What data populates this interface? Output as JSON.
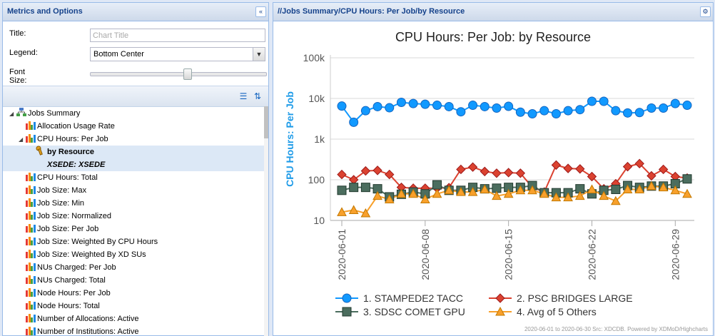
{
  "left_panel": {
    "title": "Metrics and Options",
    "collapse_icon": "double-chevron-left-icon",
    "form": {
      "title_label": "Title:",
      "title_placeholder": "Chart Title",
      "legend_label": "Legend:",
      "legend_value": "Bottom Center",
      "font_size_label": "Font Size:",
      "font_size_level": 0.55
    },
    "toolbar_icons": [
      "list-icon",
      "refresh-icon"
    ],
    "tree": [
      {
        "label": "Jobs Summary",
        "level": 0,
        "icon": "realm-icon",
        "expanded": true
      },
      {
        "label": "Allocation Usage Rate",
        "level": 1,
        "icon": "bar-chart-icon"
      },
      {
        "label": "CPU Hours: Per Job",
        "level": 1,
        "icon": "bar-chart-icon",
        "expanded": true
      },
      {
        "label": "by Resource",
        "level": 2,
        "icon": "key-icon",
        "bold": true,
        "selected": true
      },
      {
        "label": "XSEDE: XSEDE",
        "level": 2,
        "bold": true,
        "italic": true,
        "selected": true
      },
      {
        "label": "CPU Hours: Total",
        "level": 1,
        "icon": "bar-chart-icon"
      },
      {
        "label": "Job Size: Max",
        "level": 1,
        "icon": "bar-chart-icon"
      },
      {
        "label": "Job Size: Min",
        "level": 1,
        "icon": "bar-chart-icon"
      },
      {
        "label": "Job Size: Normalized",
        "level": 1,
        "icon": "bar-chart-icon"
      },
      {
        "label": "Job Size: Per Job",
        "level": 1,
        "icon": "bar-chart-icon"
      },
      {
        "label": "Job Size: Weighted By CPU Hours",
        "level": 1,
        "icon": "bar-chart-icon"
      },
      {
        "label": "Job Size: Weighted By XD SUs",
        "level": 1,
        "icon": "bar-chart-icon"
      },
      {
        "label": "NUs Charged: Per Job",
        "level": 1,
        "icon": "bar-chart-icon"
      },
      {
        "label": "NUs Charged: Total",
        "level": 1,
        "icon": "bar-chart-icon"
      },
      {
        "label": "Node Hours: Per Job",
        "level": 1,
        "icon": "bar-chart-icon"
      },
      {
        "label": "Node Hours: Total",
        "level": 1,
        "icon": "bar-chart-icon"
      },
      {
        "label": "Number of Allocations: Active",
        "level": 1,
        "icon": "bar-chart-icon"
      },
      {
        "label": "Number of Institutions: Active",
        "level": 1,
        "icon": "bar-chart-icon"
      }
    ]
  },
  "right_panel": {
    "title": "//Jobs Summary/CPU Hours: Per Job/by Resource",
    "gear_icon": "gear-icon"
  },
  "colors": {
    "accent": "#15428b",
    "s1": "#1199ff",
    "s2": "#db4230",
    "s3": "#4b6d5e",
    "s4": "#f8a02b"
  },
  "chart_data": {
    "type": "line",
    "title": "CPU Hours: Per Job: by Resource",
    "ylabel": "CPU Hours: Per Job",
    "yscale": "log",
    "ylim": [
      10,
      100000
    ],
    "yticks": [
      "10",
      "100",
      "1k",
      "10k",
      "100k"
    ],
    "x": [
      "2020-06-01",
      "2020-06-02",
      "2020-06-03",
      "2020-06-04",
      "2020-06-05",
      "2020-06-06",
      "2020-06-07",
      "2020-06-08",
      "2020-06-09",
      "2020-06-10",
      "2020-06-11",
      "2020-06-12",
      "2020-06-13",
      "2020-06-14",
      "2020-06-15",
      "2020-06-16",
      "2020-06-17",
      "2020-06-18",
      "2020-06-19",
      "2020-06-20",
      "2020-06-21",
      "2020-06-22",
      "2020-06-23",
      "2020-06-24",
      "2020-06-25",
      "2020-06-26",
      "2020-06-27",
      "2020-06-28",
      "2020-06-29",
      "2020-06-30"
    ],
    "xticks": [
      "2020-06-01",
      "2020-06-08",
      "2020-06-15",
      "2020-06-22",
      "2020-06-29"
    ],
    "series": [
      {
        "name": "1. STAMPEDE2 TACC",
        "marker": "circle",
        "values": [
          6500,
          2600,
          5000,
          6300,
          5900,
          8000,
          7500,
          7200,
          6800,
          6300,
          4700,
          6800,
          6300,
          5800,
          6400,
          4600,
          4200,
          5000,
          4200,
          5000,
          5300,
          8500,
          8500,
          5000,
          4400,
          4500,
          5800,
          5800,
          7500,
          6800
        ]
      },
      {
        "name": "2. PSC BRIDGES LARGE",
        "marker": "diamond",
        "values": [
          135,
          100,
          165,
          170,
          135,
          65,
          62,
          62,
          62,
          64,
          180,
          205,
          160,
          145,
          150,
          145,
          65,
          50,
          230,
          190,
          185,
          120,
          60,
          80,
          210,
          250,
          125,
          180,
          120,
          110
        ]
      },
      {
        "name": "3. SDSC COMET GPU",
        "marker": "square",
        "values": [
          55,
          65,
          65,
          60,
          38,
          44,
          50,
          45,
          75,
          55,
          55,
          65,
          60,
          62,
          65,
          65,
          72,
          48,
          48,
          48,
          60,
          45,
          55,
          58,
          72,
          65,
          70,
          70,
          80,
          105
        ]
      },
      {
        "name": "4. Avg of 5 Others",
        "marker": "triangle",
        "values": [
          16,
          18,
          15,
          40,
          33,
          45,
          45,
          33,
          45,
          55,
          50,
          50,
          58,
          40,
          45,
          55,
          55,
          45,
          37,
          37,
          40,
          58,
          40,
          30,
          58,
          58,
          70,
          65,
          55,
          45
        ]
      }
    ],
    "legend_placement": "bottom-center",
    "credits": "2020-06-01 to 2020-06-30 Src: XDCDB. Powered by XDMoD/Highcharts"
  }
}
